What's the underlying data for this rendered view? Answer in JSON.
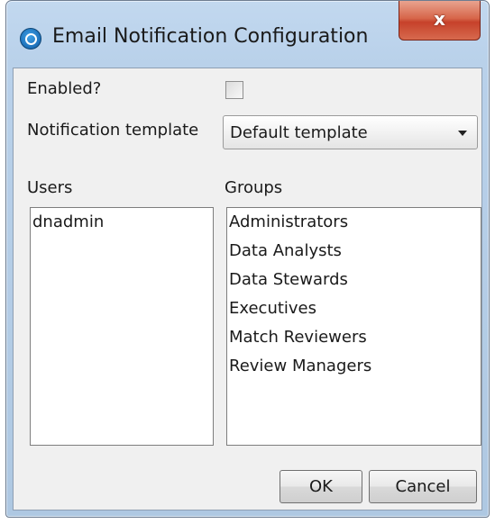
{
  "window": {
    "title": "Email Notification Configuration",
    "close_label": "x"
  },
  "form": {
    "enabled_label": "Enabled?",
    "enabled_checked": false,
    "template_label": "Notification template",
    "template_value": "Default template"
  },
  "users": {
    "header": "Users",
    "items": [
      "dnadmin"
    ]
  },
  "groups": {
    "header": "Groups",
    "items": [
      "Administrators",
      "Data Analysts",
      "Data Stewards",
      "Executives",
      "Match Reviewers",
      "Review Managers"
    ]
  },
  "buttons": {
    "ok": "OK",
    "cancel": "Cancel"
  }
}
